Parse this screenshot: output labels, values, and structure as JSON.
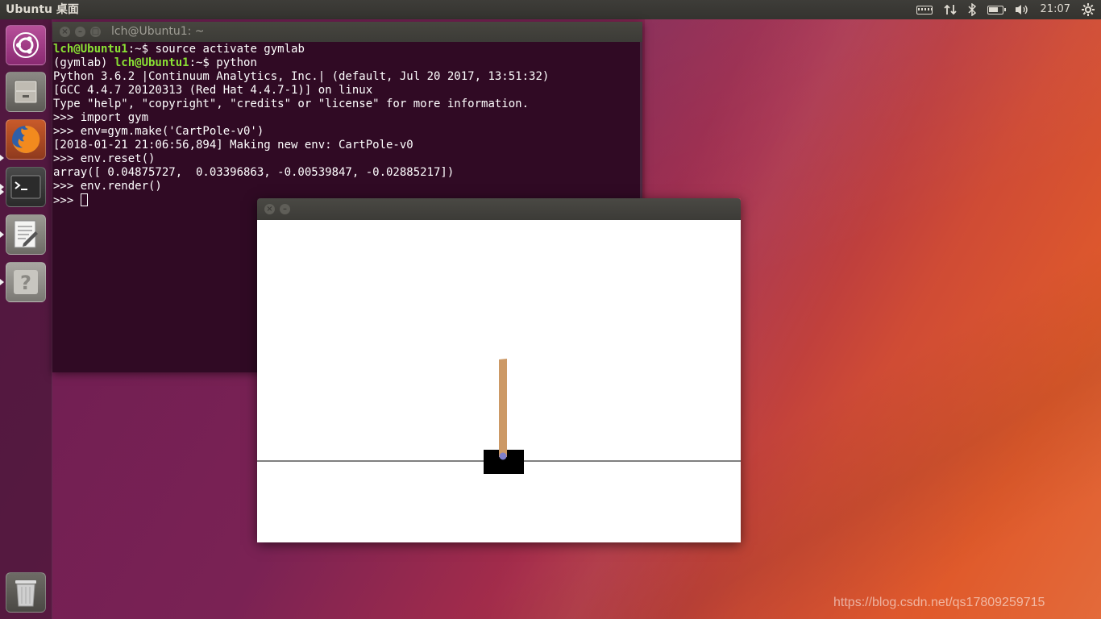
{
  "panel": {
    "title": "Ubuntu 桌面",
    "clock": "21:07"
  },
  "launcher": {
    "items": [
      {
        "name": "Dash"
      },
      {
        "name": "Files"
      },
      {
        "name": "Firefox"
      },
      {
        "name": "Terminal"
      },
      {
        "name": "Text Editor"
      },
      {
        "name": "Help"
      },
      {
        "name": "Trash"
      }
    ]
  },
  "terminal": {
    "title": "lch@Ubuntu1: ~",
    "lines": {
      "l1_user": "lch@Ubuntu1",
      "l1_sep": ":~$ ",
      "l1_cmd": "source activate gymlab",
      "l2_env": "(gymlab) ",
      "l2_user": "lch@Ubuntu1",
      "l2_sep": ":~$ ",
      "l2_cmd": "python",
      "l3": "Python 3.6.2 |Continuum Analytics, Inc.| (default, Jul 20 2017, 13:51:32)",
      "l4": "[GCC 4.4.7 20120313 (Red Hat 4.4.7-1)] on linux",
      "l5": "Type \"help\", \"copyright\", \"credits\" or \"license\" for more information.",
      "l6": ">>> import gym",
      "l7": ">>> env=gym.make('CartPole-v0')",
      "l8": "[2018-01-21 21:06:56,894] Making new env: CartPole-v0",
      "l9": ">>> env.reset()",
      "l10": "array([ 0.04875727,  0.03396863, -0.00539847, -0.02885217])",
      "l11": ">>> env.render()",
      "l12": ">>> "
    }
  },
  "gym": {
    "colors": {
      "pole": "#cc9966",
      "cart": "#000000",
      "axle": "#7f7fcc",
      "track": "#000000"
    }
  },
  "watermark": "https://blog.csdn.net/qs17809259715",
  "colors": {
    "terminal_bg": "#300a24",
    "prompt_user": "#8ae234",
    "prompt_path": "#729fcf"
  }
}
